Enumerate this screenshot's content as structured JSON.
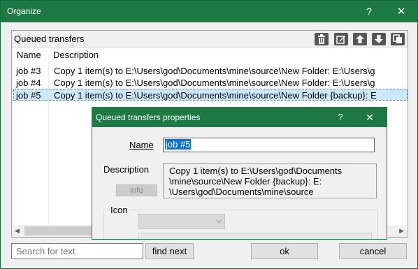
{
  "window": {
    "title": "Organize",
    "help_glyph": "?",
    "close_glyph": "✕"
  },
  "panel": {
    "title": "Queued transfers",
    "toolbar_icons": [
      "delete-icon",
      "edit-icon",
      "move-up-icon",
      "move-down-icon",
      "duplicate-icon"
    ]
  },
  "columns": [
    "Name",
    "Description"
  ],
  "rows": [
    {
      "name": "job #3",
      "description": "Copy 1 item(s) to E:\\Users\\god\\Documents\\mine\\source\\New Folder: E:\\Users\\g",
      "selected": false
    },
    {
      "name": "job #4",
      "description": "Copy 1 item(s) to E:\\Users\\god\\Documents\\mine\\source\\New Folder: E:\\Users\\g",
      "selected": false
    },
    {
      "name": "job #5",
      "description": "Copy 1 item(s) to E:\\Users\\god\\Documents\\mine\\source\\New Folder {backup}: E",
      "selected": true
    }
  ],
  "footer": {
    "search_placeholder": "Search for text",
    "find_next": "find next",
    "ok": "ok",
    "cancel": "cancel"
  },
  "dialog": {
    "title": "Queued transfers properties",
    "help_glyph": "?",
    "close_glyph": "✕",
    "name_label": "Name",
    "name_value": "job #5",
    "description_label": "Description",
    "description_lines": [
      "Copy 1 item(s) to E:\\Users\\god\\Documents",
      "\\mine\\source\\New Folder {backup}: E:",
      "\\Users\\god\\Documents\\mine\\source"
    ],
    "info_button": "info",
    "icon_label": "Icon"
  },
  "colors": {
    "title_bar": "#1e7a45",
    "selection": "#cce8ff",
    "accent": "#0078d7"
  }
}
